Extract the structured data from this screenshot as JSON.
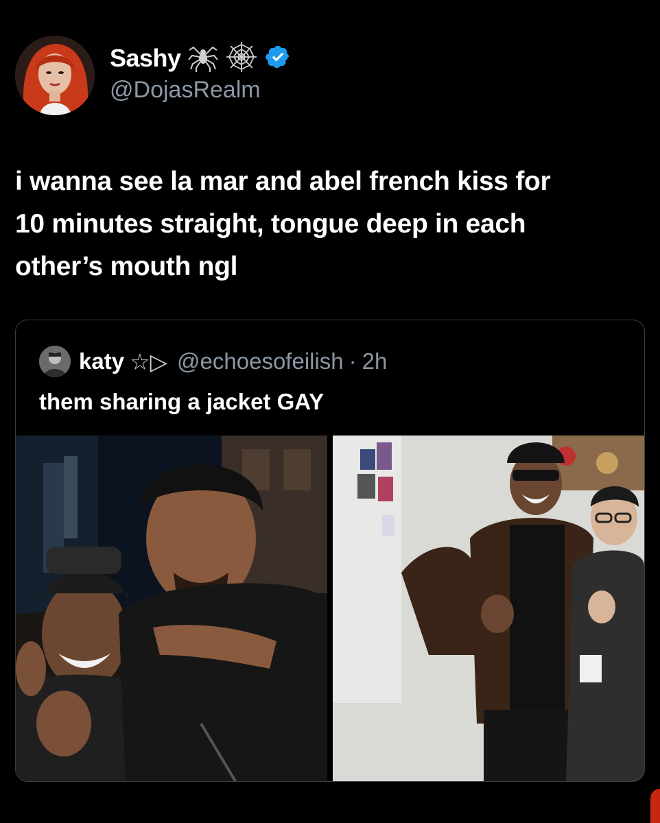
{
  "author": {
    "display_name": "Sashy",
    "handle": "@DojasRealm",
    "name_icons": [
      "spider-icon",
      "spiderweb-icon",
      "verified-badge-icon"
    ],
    "verified_color": "#1d9bf0"
  },
  "tweet": {
    "lines": [
      "i wanna see la mar and abel french kiss for",
      "10 minutes straight, tongue deep in each",
      "other’s mouth ngl"
    ]
  },
  "quote": {
    "display_name": "katy",
    "name_symbols": "☆▷",
    "handle": "@echoesofeilish",
    "separator": "·",
    "time": "2h",
    "text": "them sharing a jacket GAY",
    "photos": [
      "photo-night-selfie",
      "photo-office-duo"
    ]
  }
}
